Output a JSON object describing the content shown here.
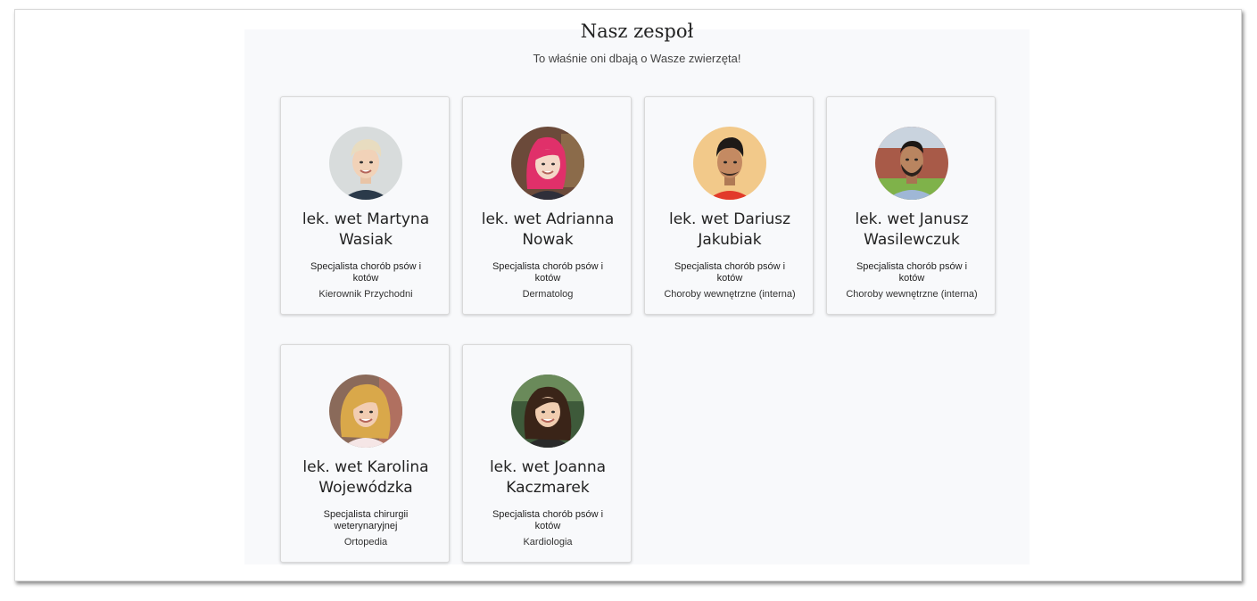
{
  "section": {
    "title": "Nasz zespoł",
    "subtitle": "To właśnie oni dbają o Wasze zwierzęta!"
  },
  "team": [
    {
      "name": "lek. wet Martyna Wasiak",
      "spec": "Specjalista chorób psów i kotów",
      "role": "Kierownik Przychodni",
      "photo": "woman-short-blonde-hair"
    },
    {
      "name": "lek. wet Adrianna Nowak",
      "spec": "Specjalista chorób psów i kotów",
      "role": "Dermatolog",
      "photo": "woman-pink-hair"
    },
    {
      "name": "lek. wet Dariusz Jakubiak",
      "spec": "Specjalista chorób psów i kotów",
      "role": "Choroby wewnętrzne (interna)",
      "photo": "man-dark-hair"
    },
    {
      "name": "lek. wet Janusz Wasilewczuk",
      "spec": "Specjalista chorób psów i kotów",
      "role": "Choroby wewnętrzne (interna)",
      "photo": "man-beard"
    },
    {
      "name": "lek. wet Karolina Wojewódzka",
      "spec": "Specjalista chirurgii weterynaryjnej",
      "role": "Ortopedia",
      "photo": "woman-curly-blonde-hair"
    },
    {
      "name": "lek. wet Joanna Kaczmarek",
      "spec": "Specjalista chorób psów i kotów",
      "role": "Kardiologia",
      "photo": "woman-brown-hair"
    }
  ]
}
